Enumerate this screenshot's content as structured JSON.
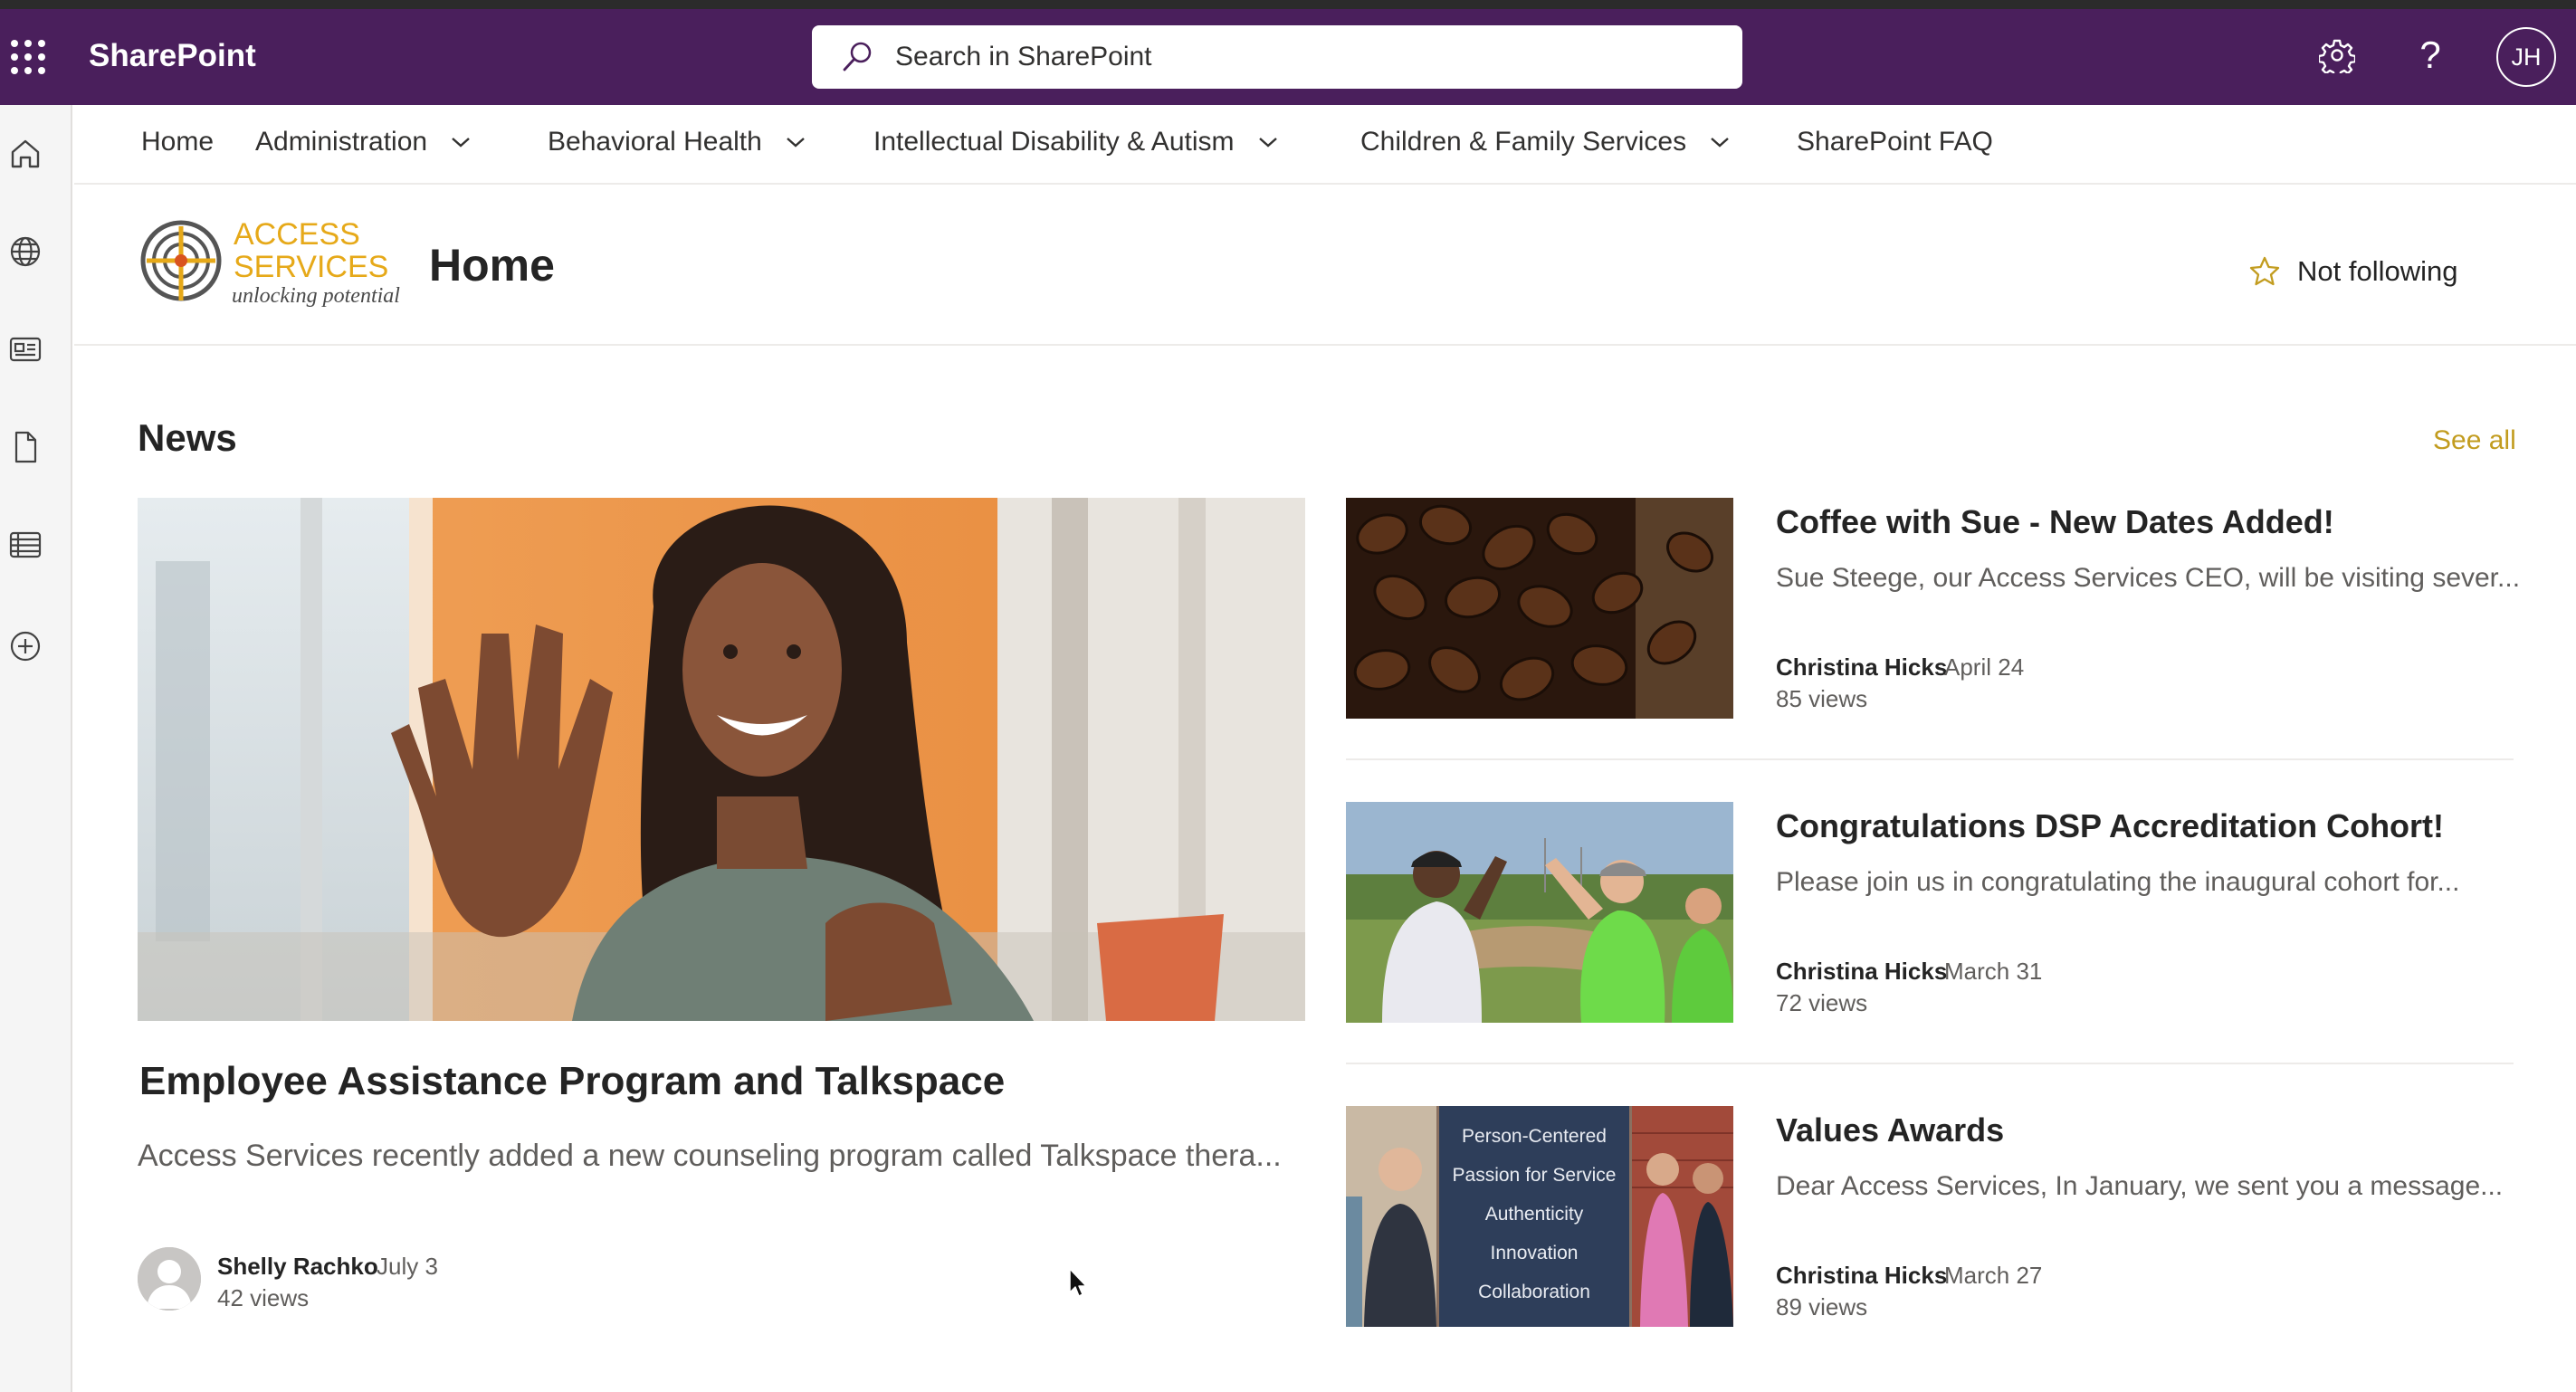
{
  "suitebar": {
    "brand": "SharePoint",
    "search_placeholder": "Search in SharePoint",
    "avatar_initials": "JH",
    "help_glyph": "?",
    "icons": [
      "app-launcher-icon",
      "search-icon",
      "gear-icon",
      "help-icon"
    ]
  },
  "rail": {
    "icons": [
      "home-icon",
      "globe-icon",
      "news-icon",
      "document-icon",
      "list-icon",
      "add-icon"
    ]
  },
  "hubnav": {
    "items": [
      {
        "label": "Home",
        "dropdown": false
      },
      {
        "label": "Administration",
        "dropdown": true
      },
      {
        "label": "Behavioral Health",
        "dropdown": true
      },
      {
        "label": "Intellectual Disability & Autism",
        "dropdown": true
      },
      {
        "label": "Children & Family Services",
        "dropdown": true
      },
      {
        "label": "SharePoint FAQ",
        "dropdown": false
      }
    ]
  },
  "site": {
    "logo_line1": "ACCESS",
    "logo_line2": "SERVICES",
    "logo_tagline": "unlocking potential",
    "title": "Home",
    "follow_label": "Not following"
  },
  "news": {
    "title": "News",
    "see_all": "See all",
    "hero": {
      "title": "Employee Assistance Program and Talkspace",
      "description": "Access Services recently added a new counseling program called Talkspace thera...",
      "author": "Shelly Rachko",
      "date": "July 3",
      "views": "42 views"
    },
    "cards": [
      {
        "title": "Coffee with Sue - New Dates Added!",
        "description": "Sue Steege, our Access Services CEO, will be visiting sever...",
        "author": "Christina Hicks",
        "date": "April 24",
        "views": "85 views"
      },
      {
        "title": "Congratulations DSP Accreditation Cohort!",
        "description": "Please join us in congratulating the inaugural cohort for...",
        "author": "Christina Hicks",
        "date": "March 31",
        "views": "72 views"
      },
      {
        "title": "Values Awards",
        "description": "Dear Access Services, In January, we sent you a message...",
        "author": "Christina Hicks",
        "date": "March 27",
        "views": "89 views",
        "image_text": [
          "Person-Centered",
          "Passion for Service",
          "Authenticity",
          "Innovation",
          "Collaboration"
        ]
      }
    ]
  },
  "colors": {
    "suitebar": "#4a1f5c",
    "accent_gold": "#c29c1f",
    "logo_gold": "#e6a919"
  }
}
